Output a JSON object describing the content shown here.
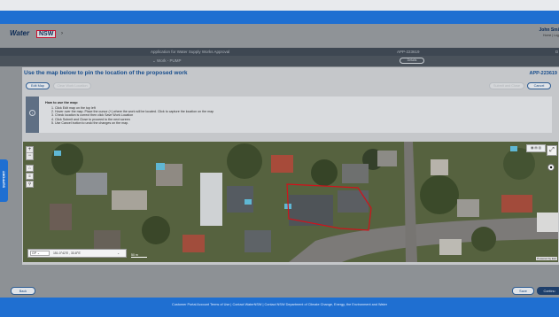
{
  "header": {
    "logo_water": "Water",
    "logo_nsw": "NSW",
    "user_name": "John Smi",
    "user_links": "Home | Log"
  },
  "appbar": {
    "title": "Application for Water Supply Works Approval",
    "app_id": "APP-223619",
    "right_text": "D"
  },
  "subbar": {
    "work_label": "Work - PUMP",
    "details_label": "Details"
  },
  "panel": {
    "title": "Use the map below to pin the location of the proposed work",
    "app_id": "APP-223619",
    "edit_map": "Edit Map",
    "clear_location": "Clear Work Location",
    "submit_close": "Submit and Close",
    "cancel": "Cancel"
  },
  "info": {
    "heading": "How to use the map:",
    "steps": [
      "1. Click Edit map on the top left",
      "2. Hover over the map. Place the cursor (+) where the work will be located. Click to capture the location on the map",
      "3. Check location is correct then click Save Work Location",
      "4. Click Submit and Close to proceed to the next screen",
      "5. Use Cancel button to undo the changes on the map."
    ]
  },
  "map": {
    "zoom_in": "+",
    "zoom_out": "−",
    "coord_system": "GP",
    "coord_value": "151.0°42'E , 33.8°S'",
    "attribution": "Powered by Esri",
    "scale": "50 m"
  },
  "support": {
    "label": "SUPPORT"
  },
  "bottom": {
    "back": "Back",
    "save": "Save",
    "continue": "Continu"
  },
  "footer": {
    "links": "Customer Portal Account Terms of Use  |  Contact WaterNSW  |  Contact NSW Department of Climate Change, Energy, the Environment and Water"
  },
  "colors": {
    "brand_blue": "#1f6fd1",
    "title_blue": "#164c8c",
    "polygon_red": "#d0121b"
  }
}
